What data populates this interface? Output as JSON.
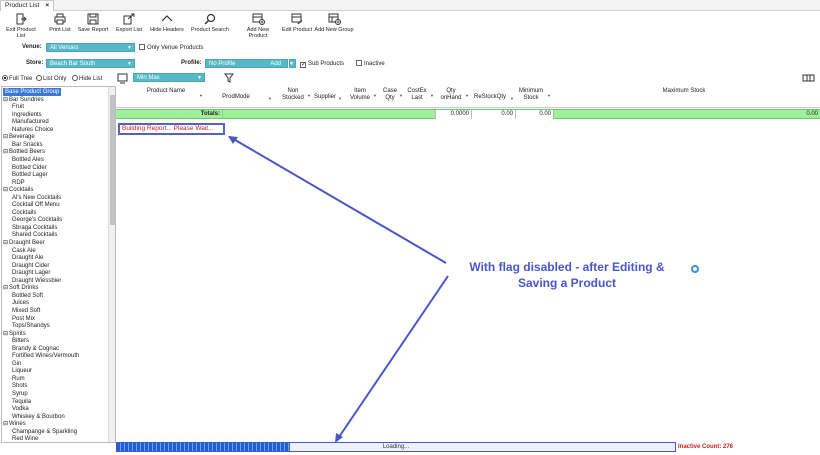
{
  "tab": {
    "title": "Product List",
    "close": "×"
  },
  "toolbar": [
    {
      "label": "Exit Product List",
      "icon": "exit-icon"
    },
    {
      "label": "Print List",
      "icon": "printer-icon"
    },
    {
      "label": "Save Report",
      "icon": "save-icon"
    },
    {
      "label": "Export List",
      "icon": "export-icon"
    },
    {
      "label": "Hide Headers",
      "icon": "chevron-up-icon"
    },
    {
      "label": "Product Search",
      "icon": "search-icon"
    },
    {
      "label": "Add New Product",
      "icon": "add-product-icon"
    },
    {
      "label": "Edit Product",
      "icon": "edit-icon"
    },
    {
      "label": "Add New Group",
      "icon": "add-group-icon"
    }
  ],
  "filters": {
    "venue_label": "Venue:",
    "venue_value": "All Venues",
    "only_venue_products": "Only Venue Products",
    "store_label": "Store:",
    "store_value": "Beach Bar South",
    "profile_label": "Profile:",
    "profile_value": "No Profile",
    "profile_add": "Add",
    "sub_products": "Sub Products",
    "inactive": "Inactive"
  },
  "view": {
    "full_tree": "Full Tree",
    "list_only": "List Only",
    "hide_list": "Hide List",
    "minmax_value": "Min Max"
  },
  "tree": [
    {
      "label": "Base Product Group",
      "level": 0,
      "selected": true
    },
    {
      "label": "Bar Sundries",
      "level": 1,
      "group": true
    },
    {
      "label": "Fruit",
      "level": 2
    },
    {
      "label": "Ingredients",
      "level": 2
    },
    {
      "label": "Manufactured",
      "level": 2
    },
    {
      "label": "Natures Choice",
      "level": 2
    },
    {
      "label": "Beverage",
      "level": 1,
      "group": true
    },
    {
      "label": "Bar Snacks",
      "level": 2
    },
    {
      "label": "Bottled Beers",
      "level": 1,
      "group": true
    },
    {
      "label": "Bottled Ales",
      "level": 2
    },
    {
      "label": "Bottled Cider",
      "level": 2
    },
    {
      "label": "Bottled Lager",
      "level": 2
    },
    {
      "label": "RDP",
      "level": 2
    },
    {
      "label": "Cocktails",
      "level": 1,
      "group": true
    },
    {
      "label": "Al's New Cocktails",
      "level": 2
    },
    {
      "label": "Cocktail Off Menu",
      "level": 2
    },
    {
      "label": "Cocktails",
      "level": 2
    },
    {
      "label": "George's Cocktails",
      "level": 2
    },
    {
      "label": "Sbraga Cocktails",
      "level": 2
    },
    {
      "label": "Shared Cocktails",
      "level": 2
    },
    {
      "label": "Draught Beer",
      "level": 1,
      "group": true
    },
    {
      "label": "Cask Ale",
      "level": 2
    },
    {
      "label": "Draught Ale",
      "level": 2
    },
    {
      "label": "Draught Cider",
      "level": 2
    },
    {
      "label": "Draught Lager",
      "level": 2
    },
    {
      "label": "Draught Wiessbier",
      "level": 2
    },
    {
      "label": "Soft Drinks",
      "level": 1,
      "group": true
    },
    {
      "label": "Bottled Soft",
      "level": 2
    },
    {
      "label": "Juices",
      "level": 2
    },
    {
      "label": "Mixed Soft",
      "level": 2
    },
    {
      "label": "Post Mix",
      "level": 2
    },
    {
      "label": "Tops/Shandys",
      "level": 2
    },
    {
      "label": "Spirits",
      "level": 1,
      "group": true
    },
    {
      "label": "Bitters",
      "level": 2
    },
    {
      "label": "Brandy & Cognac",
      "level": 2
    },
    {
      "label": "Fortified Wines/Vermouth",
      "level": 2
    },
    {
      "label": "Gin",
      "level": 2
    },
    {
      "label": "Liqueur",
      "level": 2
    },
    {
      "label": "Rum",
      "level": 2
    },
    {
      "label": "Shots",
      "level": 2
    },
    {
      "label": "Syrup",
      "level": 2
    },
    {
      "label": "Tequila",
      "level": 2
    },
    {
      "label": "Vodka",
      "level": 2
    },
    {
      "label": "Whiskey & Bourbon",
      "level": 2
    },
    {
      "label": "Wines",
      "level": 1,
      "group": true
    },
    {
      "label": "Champange & Sparkling",
      "level": 2
    },
    {
      "label": "Red Wine",
      "level": 2
    }
  ],
  "grid": {
    "headers": [
      "Product Name",
      "ProdMode",
      "Non Stocked",
      "Supplier",
      "Item Volume",
      "Case Qty",
      "CostEx Last",
      "Qty onHand",
      "ReStockQty",
      "Minimum Stock",
      "Maximum Stock"
    ],
    "totals_label": "Totals:",
    "totals": {
      "qty_onhand": "0.0000",
      "restock": "0.00",
      "minimum": "0.00",
      "maximum": "0.00"
    }
  },
  "status": {
    "building": "Building Report... Please Wait...",
    "loading": "Loading...",
    "progress": 0.31,
    "inactive_count": "Inactive Count: 276"
  },
  "annotation": {
    "line1": "With flag disabled - after Editing &",
    "line2": "Saving a Product"
  },
  "colors": {
    "accent": "#57b8c8",
    "totals_row": "#9ef09a",
    "annotation": "#4857c8",
    "progress": "#1f5fd6",
    "selected": "#3a78d8"
  }
}
